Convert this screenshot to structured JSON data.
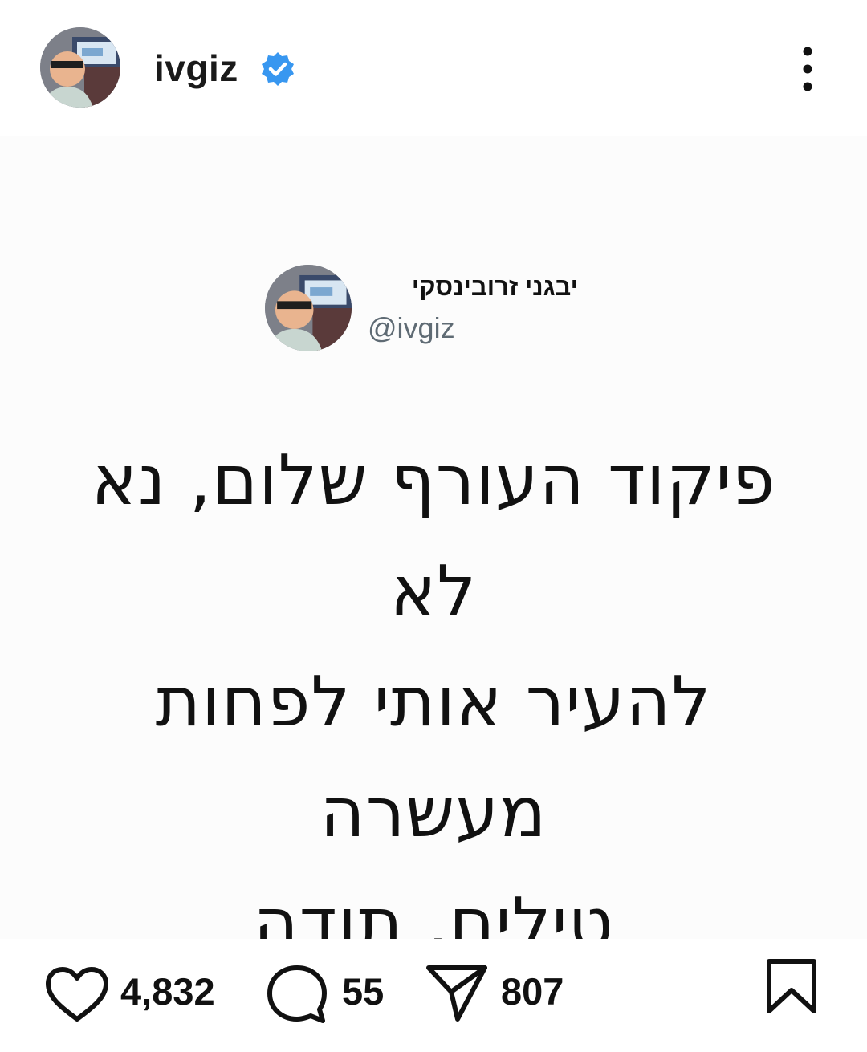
{
  "header": {
    "username": "ivgiz",
    "verified_color": "#3897f0"
  },
  "tweet": {
    "display_name": "יבגני זרובינסקי",
    "handle": "@ivgiz",
    "text_lines": [
      "פיקוד העורף שלום, נא לא",
      "להעיר אותי לפחות מעשרה",
      "טילים, תודה"
    ]
  },
  "actions": {
    "likes": "4,832",
    "comments": "55",
    "shares": "807"
  },
  "icons": {
    "more": "more-vertical-icon",
    "like": "heart-icon",
    "comment": "comment-icon",
    "share": "send-icon",
    "save": "bookmark-icon",
    "verified": "verified-badge-icon"
  }
}
